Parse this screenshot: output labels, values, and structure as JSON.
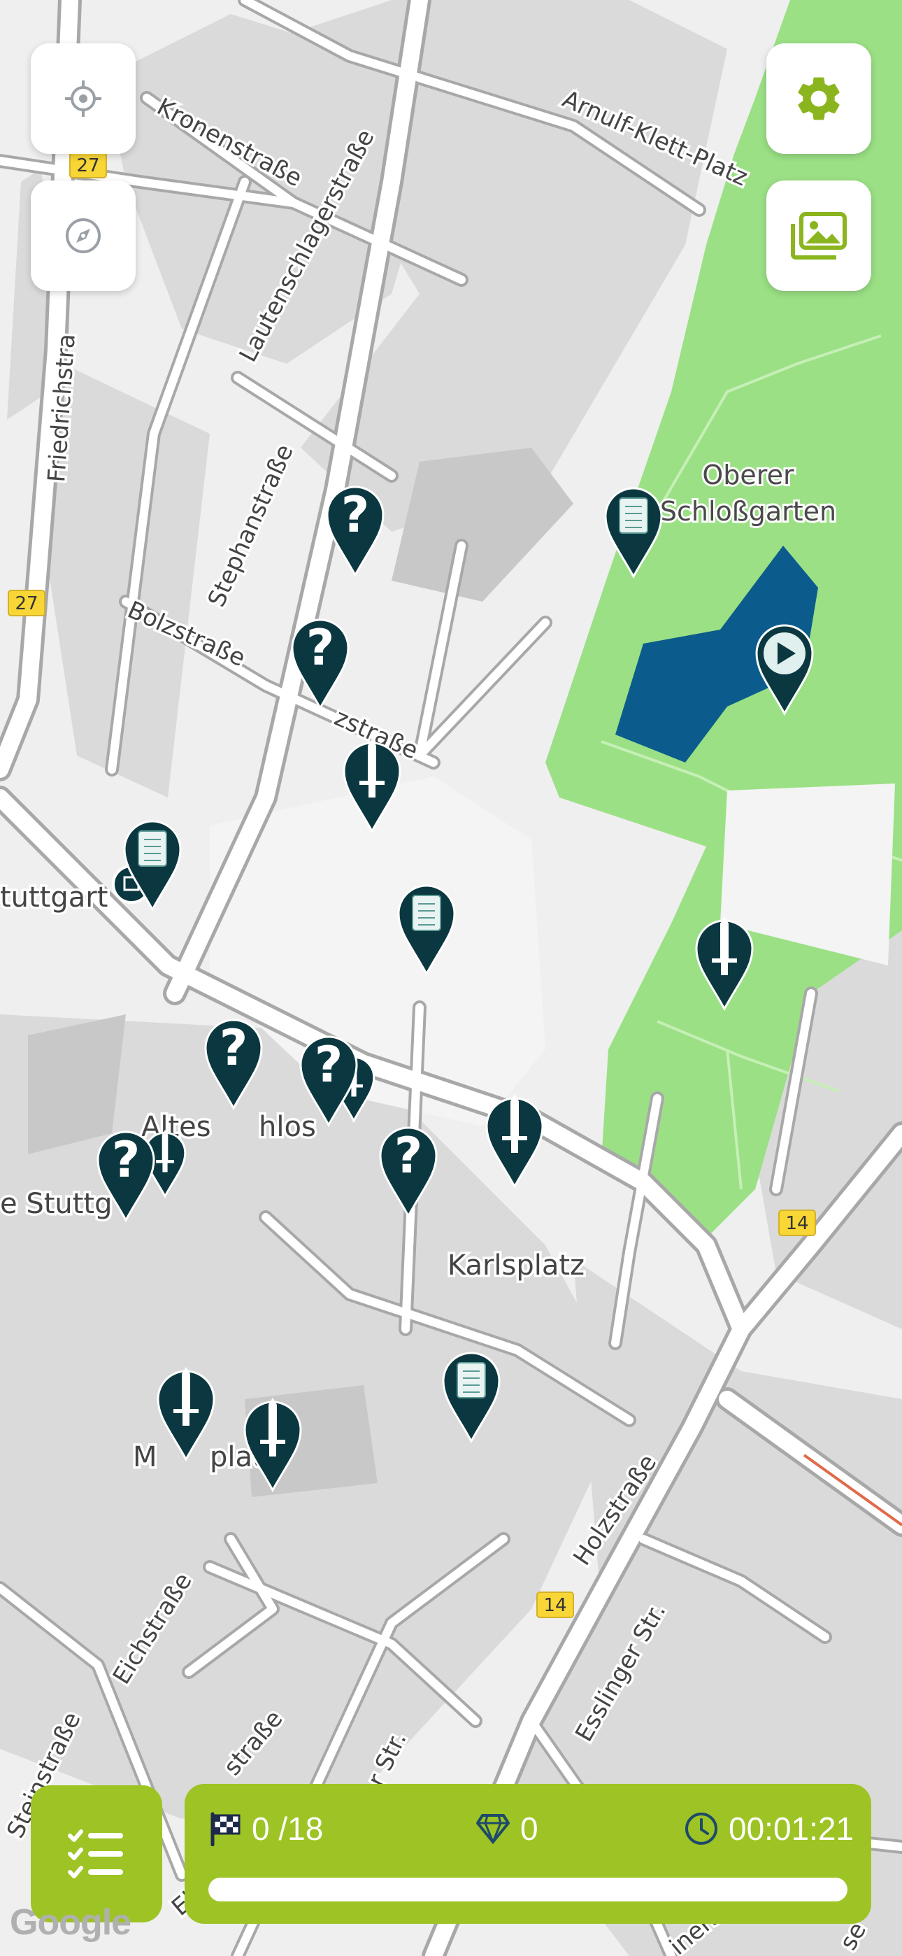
{
  "map": {
    "streets": [
      "Kronenstraße",
      "Lautenschlagerstraße",
      "Arnulf-Klett-Platz",
      "Friedrichstra",
      "Stephanstraße",
      "Bolzstraße",
      "zstraße",
      "Holzstraße",
      "Eichstraße",
      "Esslinger Str.",
      "Steinstraße",
      "Ebe",
      "straße",
      "r Str.",
      "inerstr",
      "se"
    ],
    "places": [
      "Oberer",
      "Schloßgarten",
      "Karlsplatz",
      "Altes",
      "hlos",
      "tuttgart",
      "e Stuttg",
      "M",
      "plat"
    ],
    "route_shields": [
      "27",
      "27",
      "14",
      "14"
    ],
    "attribution": "Google"
  },
  "controls": {
    "locate_icon": "crosshair-icon",
    "compass_icon": "compass-icon",
    "settings_icon": "gear-icon",
    "gallery_icon": "image-gallery-icon",
    "tasks_icon": "checklist-icon"
  },
  "status": {
    "flags_text": "0 /18",
    "gems_text": "0",
    "time_text": "00:01:21",
    "progress_fraction": 0
  },
  "colors": {
    "accent": "#9dc424",
    "marker": "#0b3840",
    "park": "#9be085",
    "water": "#0b5c8c",
    "road_shield": "#f8d636"
  }
}
